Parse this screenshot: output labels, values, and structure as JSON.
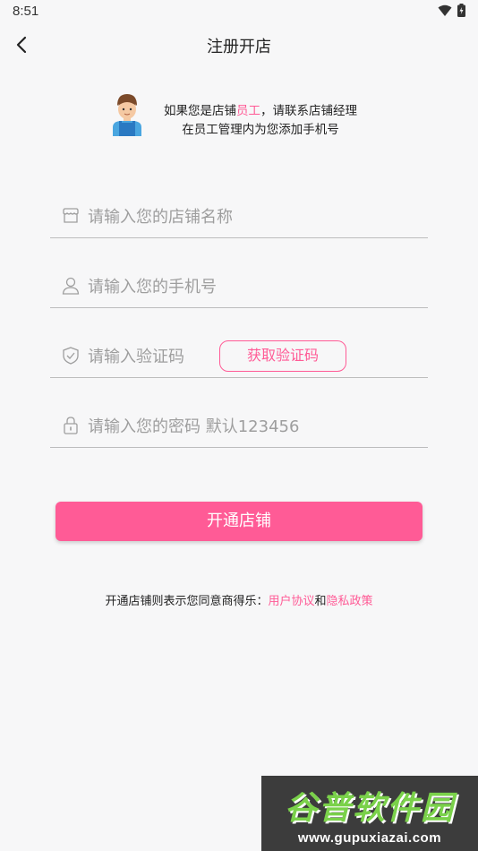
{
  "status_bar": {
    "time": "8:51"
  },
  "nav": {
    "title": "注册开店"
  },
  "notice": {
    "line1_prefix": "如果您是店铺",
    "line1_highlight": "员工",
    "line1_suffix": "，请联系店铺经理",
    "line2": "在员工管理内为您添加手机号"
  },
  "form": {
    "store_name_placeholder": "请输入您的店铺名称",
    "phone_placeholder": "请输入您的手机号",
    "code_placeholder": "请输入验证码",
    "get_code_label": "获取验证码",
    "password_placeholder": "请输入您的密码 默认123456"
  },
  "submit": {
    "label": "开通店铺"
  },
  "agreement": {
    "prefix": "开通店铺则表示您同意商得乐：",
    "user_agreement": "用户协议",
    "and": "和",
    "privacy_policy": "隐私政策"
  },
  "watermark": {
    "title": "谷普软件园",
    "url": "www.gupuxiazai.com"
  },
  "colors": {
    "accent": "#ff5b96",
    "background": "#f7f7f8",
    "divider": "#bdbdbd"
  }
}
